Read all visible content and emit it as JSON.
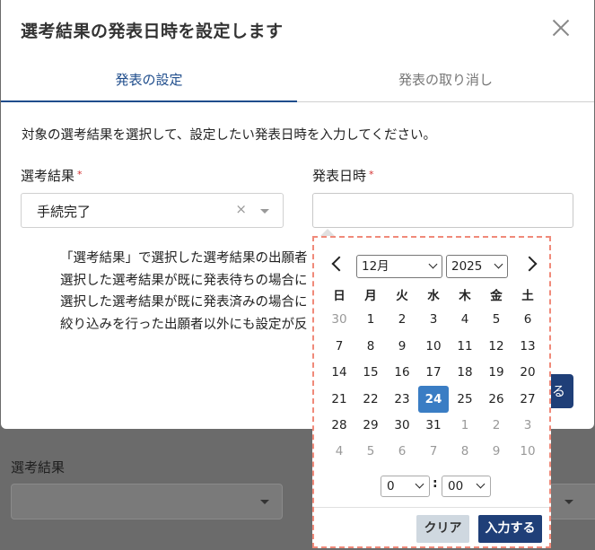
{
  "background": {
    "field_label": "選考結果"
  },
  "modal": {
    "title": "選考結果の発表日時を設定します",
    "tabs": [
      {
        "label": "発表の設定",
        "active": true
      },
      {
        "label": "発表の取り消し",
        "active": false
      }
    ],
    "description": "対象の選考結果を選択して、設定したい発表日時を入力してください。",
    "selection_field": {
      "label": "選考結果",
      "required_mark": "*",
      "value": "手続完了",
      "clear_symbol": "×"
    },
    "datetime_field": {
      "label": "発表日時",
      "required_mark": "*",
      "value": ""
    },
    "notes": [
      "「選考結果」で選択した選考結果の出願者",
      "選択した選考結果が既に発表待ちの場合に",
      "選択した選考結果が既に発表済みの場合に",
      "絞り込みを行った出願者以外にも設定が反"
    ],
    "partial_button_text": "る"
  },
  "datepicker": {
    "month": "12月",
    "year": "2025",
    "weekdays": [
      "日",
      "月",
      "火",
      "水",
      "木",
      "金",
      "土"
    ],
    "weeks": [
      [
        "30",
        "1",
        "2",
        "3",
        "4",
        "5",
        "6"
      ],
      [
        "7",
        "8",
        "9",
        "10",
        "11",
        "12",
        "13"
      ],
      [
        "14",
        "15",
        "16",
        "17",
        "18",
        "19",
        "20"
      ],
      [
        "21",
        "22",
        "23",
        "24",
        "25",
        "26",
        "27"
      ],
      [
        "28",
        "29",
        "30",
        "31",
        "1",
        "2",
        "3"
      ],
      [
        "4",
        "5",
        "6",
        "7",
        "8",
        "9",
        "10"
      ]
    ],
    "selected_day": "24",
    "hour": "0",
    "minute": "00",
    "time_separator": ":",
    "clear_label": "クリア",
    "submit_label": "入力する",
    "colors": {
      "selected": "#3a7dc4",
      "primary": "#1f3f78"
    }
  }
}
